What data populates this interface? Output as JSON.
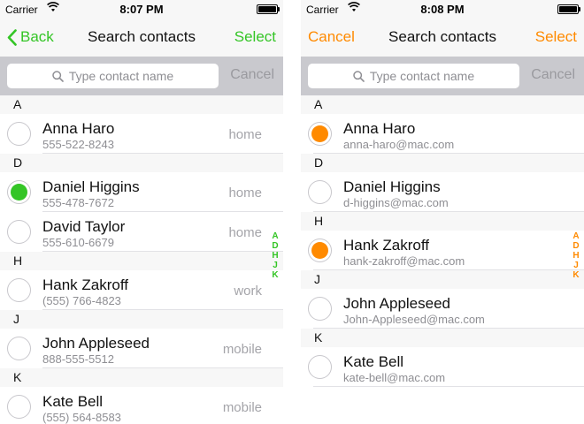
{
  "status": {
    "carrier": "Carrier"
  },
  "left": {
    "accent": "#34c526",
    "time": "8:07 PM",
    "nav": {
      "back_label": "Back",
      "title": "Search contacts",
      "right_label": "Select"
    },
    "search": {
      "placeholder": "Type contact name",
      "cancel_label": "Cancel"
    },
    "sections": [
      {
        "letter": "A",
        "rows": [
          {
            "name": "Anna Haro",
            "detail": "555-522-8243",
            "type": "home",
            "selected": false
          }
        ]
      },
      {
        "letter": "D",
        "rows": [
          {
            "name": "Daniel Higgins",
            "detail": "555-478-7672",
            "type": "home",
            "selected": true
          },
          {
            "name": "David Taylor",
            "detail": "555-610-6679",
            "type": "home",
            "selected": false
          }
        ]
      },
      {
        "letter": "H",
        "rows": [
          {
            "name": "Hank Zakroff",
            "detail": "(555) 766-4823",
            "type": "work",
            "selected": false
          }
        ]
      },
      {
        "letter": "J",
        "rows": [
          {
            "name": "John Appleseed",
            "detail": "888-555-5512",
            "type": "mobile",
            "selected": false
          }
        ]
      },
      {
        "letter": "K",
        "rows": [
          {
            "name": "Kate Bell",
            "detail": "(555) 564-8583",
            "type": "mobile",
            "selected": false
          }
        ]
      }
    ],
    "index": [
      "A",
      "D",
      "H",
      "J",
      "K"
    ]
  },
  "right": {
    "accent": "#ff8a00",
    "time": "8:08 PM",
    "nav": {
      "left_label": "Cancel",
      "title": "Search contacts",
      "right_label": "Select"
    },
    "search": {
      "placeholder": "Type contact name",
      "cancel_label": "Cancel"
    },
    "sections": [
      {
        "letter": "A",
        "rows": [
          {
            "name": "Anna Haro",
            "detail": "anna-haro@mac.com",
            "selected": true
          }
        ]
      },
      {
        "letter": "D",
        "rows": [
          {
            "name": "Daniel Higgins",
            "detail": "d-higgins@mac.com",
            "selected": false
          }
        ]
      },
      {
        "letter": "H",
        "rows": [
          {
            "name": "Hank Zakroff",
            "detail": "hank-zakroff@mac.com",
            "selected": true
          }
        ]
      },
      {
        "letter": "J",
        "rows": [
          {
            "name": "John Appleseed",
            "detail": "John-Appleseed@mac.com",
            "selected": false
          }
        ]
      },
      {
        "letter": "K",
        "rows": [
          {
            "name": "Kate Bell",
            "detail": "kate-bell@mac.com",
            "selected": false
          }
        ]
      }
    ],
    "index": [
      "A",
      "D",
      "H",
      "J",
      "K"
    ]
  }
}
